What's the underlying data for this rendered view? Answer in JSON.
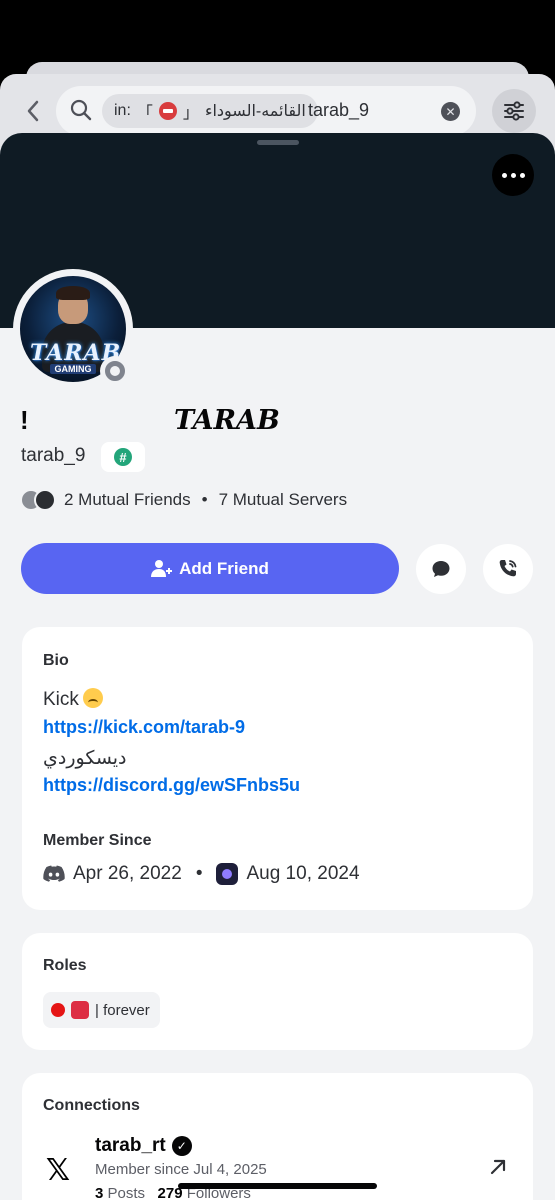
{
  "search": {
    "scope_prefix": "in:",
    "scope_open": "「",
    "scope_name": "القائمه-السوداء",
    "scope_close": "」",
    "query": "tarab_9"
  },
  "profile": {
    "display_name_prefix": "!",
    "display_name_styled": "TARAB",
    "avatar_logo": "TARAB",
    "avatar_logo_sub": "GAMING",
    "username": "tarab_9",
    "tag_symbol": "#",
    "mutual_friends": "2 Mutual Friends",
    "separator": "•",
    "mutual_servers": "7 Mutual Servers",
    "status": "offline"
  },
  "actions": {
    "add_friend_label": "Add Friend"
  },
  "bio": {
    "title": "Bio",
    "line1": "Kick",
    "link1": "https://kick.com/tarab-9",
    "line2": "ديسكوردي",
    "link2": "https://discord.gg/ewSFnbs5u"
  },
  "member_since": {
    "title": "Member Since",
    "discord_date": "Apr 26, 2022",
    "separator": "•",
    "server_date": "Aug 10, 2024"
  },
  "roles": {
    "title": "Roles",
    "role_label": "| forever"
  },
  "connections": {
    "title": "Connections",
    "items": [
      {
        "platform_icon": "x-logo-icon",
        "name": "tarab_rt",
        "verified": true,
        "since": "Member since Jul 4, 2025",
        "posts_count": "3",
        "posts_label": "Posts",
        "followers_count": "279",
        "followers_label": "Followers"
      }
    ]
  },
  "colors": {
    "brand": "#5865f2",
    "banner": "#0f1b24",
    "link": "#006ce7",
    "background": "#f2f3f5"
  }
}
